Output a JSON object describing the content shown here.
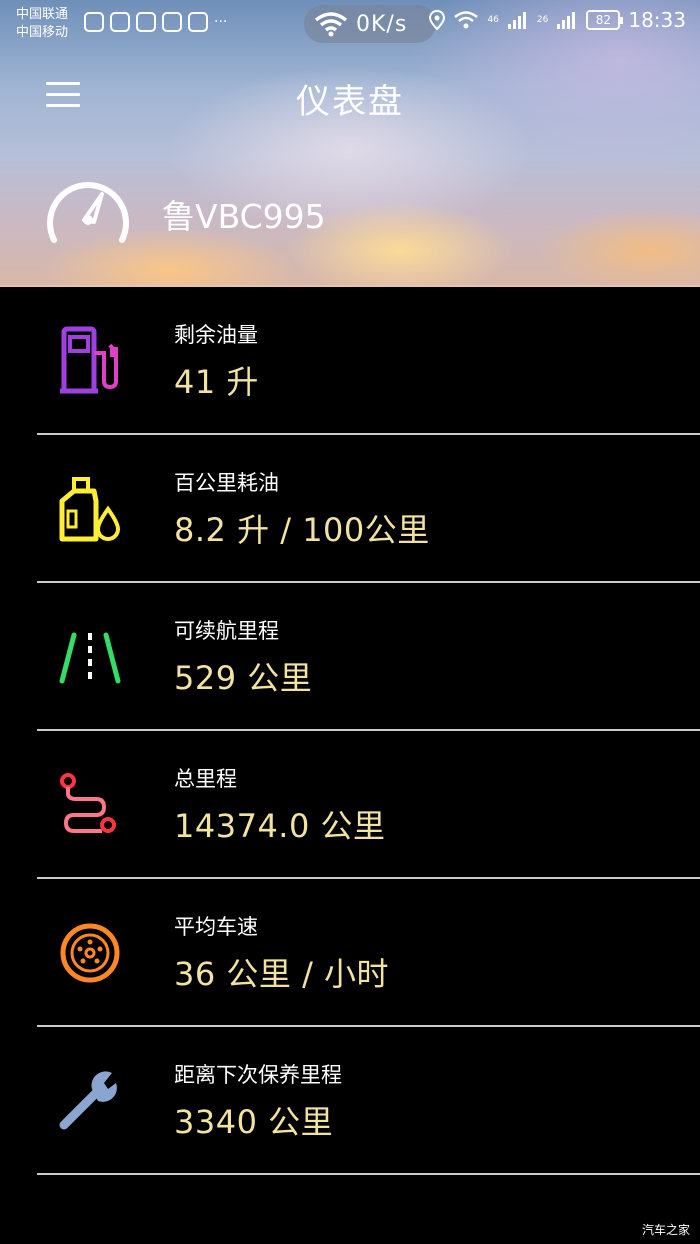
{
  "status_bar": {
    "carrier_1": "中国联通",
    "carrier_2": "中国移动",
    "speed": "0K/s",
    "signal_1": "46",
    "signal_2": "26",
    "battery": "82",
    "time": "18:33"
  },
  "app_bar": {
    "title": "仪表盘",
    "menu_icon": "hamburger-menu-icon"
  },
  "vehicle": {
    "plate": "鲁VBC995",
    "icon": "speedometer-icon"
  },
  "metrics": [
    {
      "label": "剩余油量",
      "value": "41 升",
      "icon": "fuel-pump-icon",
      "color": "#a040e0"
    },
    {
      "label": "百公里耗油",
      "value": "8.2 升 / 100公里",
      "icon": "oil-can-icon",
      "color": "#ffee33"
    },
    {
      "label": "可续航里程",
      "value": "529 公里",
      "icon": "road-icon",
      "color": "#33dd66"
    },
    {
      "label": "总里程",
      "value": "14374.0 公里",
      "icon": "route-icon",
      "color": "#ff4455"
    },
    {
      "label": "平均车速",
      "value": "36 公里 / 小时",
      "icon": "wheel-icon",
      "color": "#ff8822"
    },
    {
      "label": "距离下次保养里程",
      "value": "3340 公里",
      "icon": "wrench-icon",
      "color": "#8aa6d0"
    }
  ],
  "watermark": "汽车之家",
  "colors": {
    "value_text": "#f3e3a0",
    "background": "#000000",
    "divider": "#c9c9c9"
  }
}
